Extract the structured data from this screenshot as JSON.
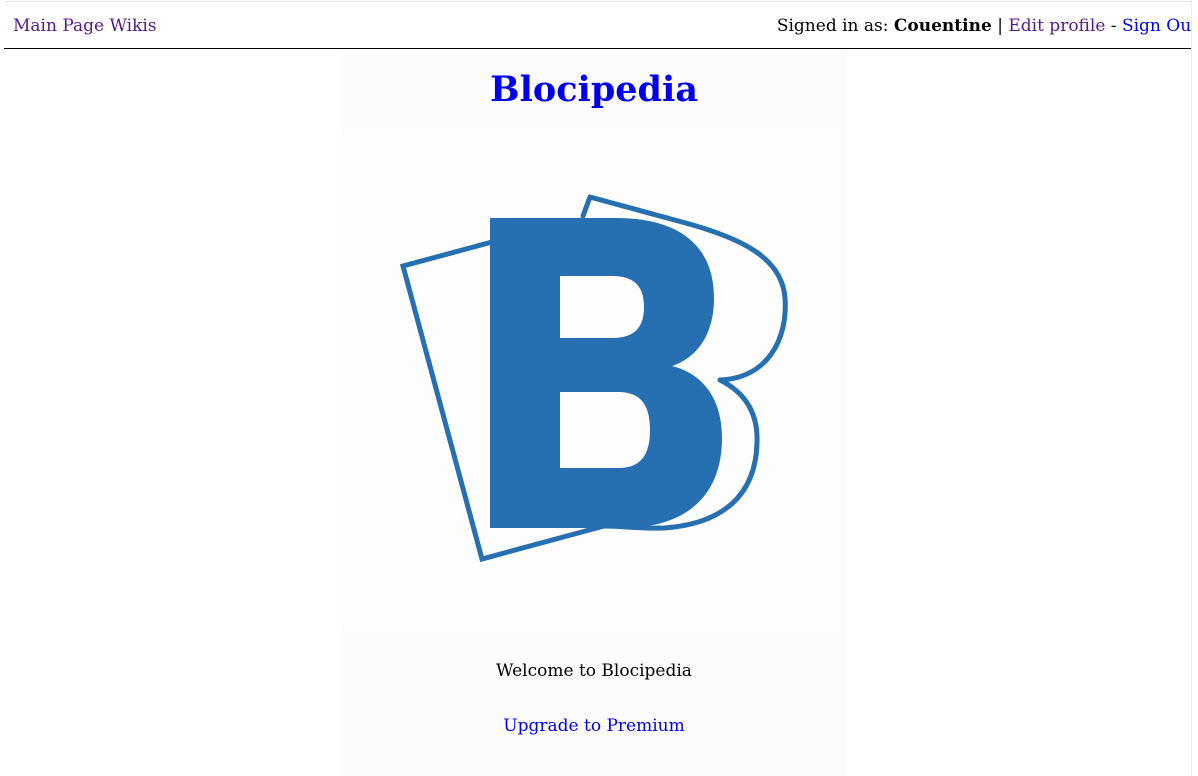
{
  "nav": {
    "main_page": "Main Page",
    "wikis": "Wikis",
    "signed_in_prefix": "Signed in as:",
    "username": "Couentine",
    "separator_pipe": "|",
    "edit_profile": "Edit profile",
    "separator_dash": "-",
    "sign_out": "Sign Out"
  },
  "main": {
    "title": "Blocipedia",
    "logo_letter": "B",
    "welcome": "Welcome to Blocipedia",
    "upgrade": "Upgrade to Premium"
  },
  "colors": {
    "logo_blue": "#2670b2",
    "link": "#0000ee",
    "visited_link": "#551a8b"
  }
}
